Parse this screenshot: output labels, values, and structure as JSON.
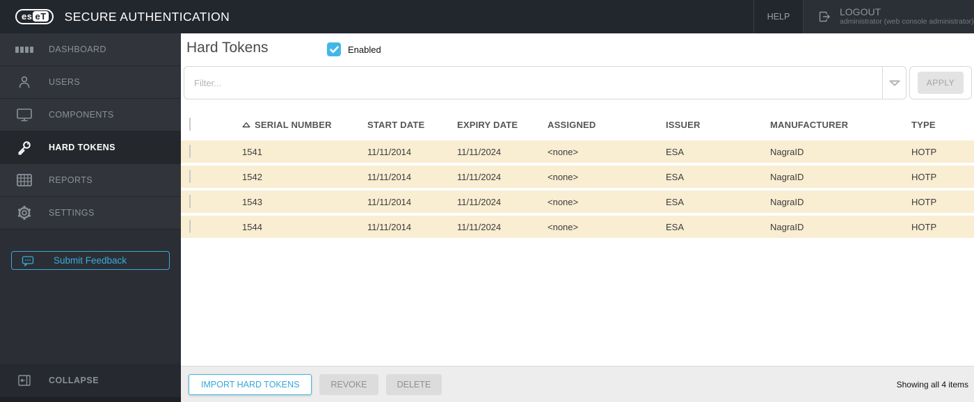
{
  "topbar": {
    "logo_text_left": "es",
    "logo_text_right": "eT",
    "brand": "SECURE AUTHENTICATION",
    "help_label": "HELP",
    "logout": {
      "label": "LOGOUT",
      "subtitle": "administrator (web console administrator)"
    }
  },
  "sidebar": {
    "items": [
      {
        "label": "DASHBOARD",
        "icon": "dashboard-icon",
        "active": false
      },
      {
        "label": "USERS",
        "icon": "users-icon",
        "active": false
      },
      {
        "label": "COMPONENTS",
        "icon": "components-icon",
        "active": false
      },
      {
        "label": "HARD TOKENS",
        "icon": "key-icon",
        "active": true
      },
      {
        "label": "REPORTS",
        "icon": "reports-icon",
        "active": false
      },
      {
        "label": "SETTINGS",
        "icon": "settings-icon",
        "active": false
      }
    ],
    "feedback_label": "Submit Feedback",
    "collapse_label": "COLLAPSE"
  },
  "main": {
    "title": "Hard Tokens",
    "enabled_label": "Enabled",
    "enabled_checked": true,
    "filter_placeholder": "Filter...",
    "apply_label": "APPLY",
    "table": {
      "columns": {
        "serial": "SERIAL NUMBER",
        "start": "START DATE",
        "expiry": "EXPIRY DATE",
        "assigned": "ASSIGNED",
        "issuer": "ISSUER",
        "manufacturer": "MANUFACTURER",
        "type": "TYPE"
      },
      "sort": {
        "column": "serial",
        "direction": "asc"
      },
      "rows": [
        {
          "serial": "1541",
          "start": "11/11/2014",
          "expiry": "11/11/2024",
          "assigned": "<none>",
          "issuer": "ESA",
          "manufacturer": "NagraID",
          "type": "HOTP"
        },
        {
          "serial": "1542",
          "start": "11/11/2014",
          "expiry": "11/11/2024",
          "assigned": "<none>",
          "issuer": "ESA",
          "manufacturer": "NagraID",
          "type": "HOTP"
        },
        {
          "serial": "1543",
          "start": "11/11/2014",
          "expiry": "11/11/2024",
          "assigned": "<none>",
          "issuer": "ESA",
          "manufacturer": "NagraID",
          "type": "HOTP"
        },
        {
          "serial": "1544",
          "start": "11/11/2014",
          "expiry": "11/11/2024",
          "assigned": "<none>",
          "issuer": "ESA",
          "manufacturer": "NagraID",
          "type": "HOTP"
        }
      ]
    },
    "footer": {
      "import_label": "IMPORT HARD TOKENS",
      "revoke_label": "REVOKE",
      "delete_label": "DELETE",
      "summary": "Showing all 4 items"
    }
  },
  "colors": {
    "accent_blue": "#41b7e8",
    "feedback_blue": "#3aabdb",
    "topbar_bg": "#22262d",
    "sidebar_bg": "#31353b",
    "sidebar_active_bg": "#24272c",
    "row_bg": "#f9edd2",
    "footer_bg": "#ededed"
  }
}
